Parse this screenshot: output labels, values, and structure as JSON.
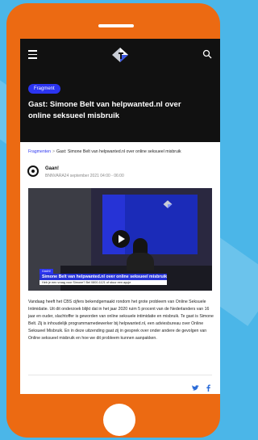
{
  "colors": {
    "background": "#4bb6e8",
    "phone": "#ec6a12",
    "accent": "#2b34f0",
    "header": "#111111"
  },
  "topbar": {
    "menu_icon": "hamburger-icon",
    "logo": "broadcaster-logo",
    "search_icon": "search-icon"
  },
  "hero": {
    "badge": "Fragment",
    "title": "Gast: Simone Belt van helpwanted.nl over online seksueel misbruik"
  },
  "breadcrumb": {
    "parent": "Fragmenten",
    "separator": ">",
    "current": "Gast: Simone Belt van helpwanted.nl over online seksueel misbruik"
  },
  "author": {
    "name": "Gaan!",
    "meta": "BNNVARA24 september 2021 04:00 - 06:00"
  },
  "video": {
    "lower_third_tag": "GAAN!",
    "lower_third_title": "Simone Belt van helpwanted.nl over online seksueel misbruik",
    "lower_third_sub": "Heb je een vraag voor Simone? Bel 0800-1121 of stuur een appje",
    "play_icon": "play-icon"
  },
  "article": {
    "body": "Vandaag heeft het CBS cijfers bekendgemaakt rondom het grote probleem van Online Seksuele Intimidatie. Uit dit onderzoek blijkt dat in het jaar 2020 ruim 5 procent van de Nederlanders van 16 jaar en ouder, slachtoffer is geworden van online seksuele intimidatie en misbruik. Te gast is Simone Belt. Zij is inhoudelijk programmamedewerker bij helpwanted.nl, een adviesbureau over Online Seksueel Misbruik. En in deze uitzending gaat zij in gesprek over onder andere de gevolgen van Online seksueel misbruik en hoe we dit probleem kunnen aanpakken."
  },
  "share": {
    "twitter_icon": "twitter-icon",
    "facebook_icon": "facebook-icon"
  }
}
